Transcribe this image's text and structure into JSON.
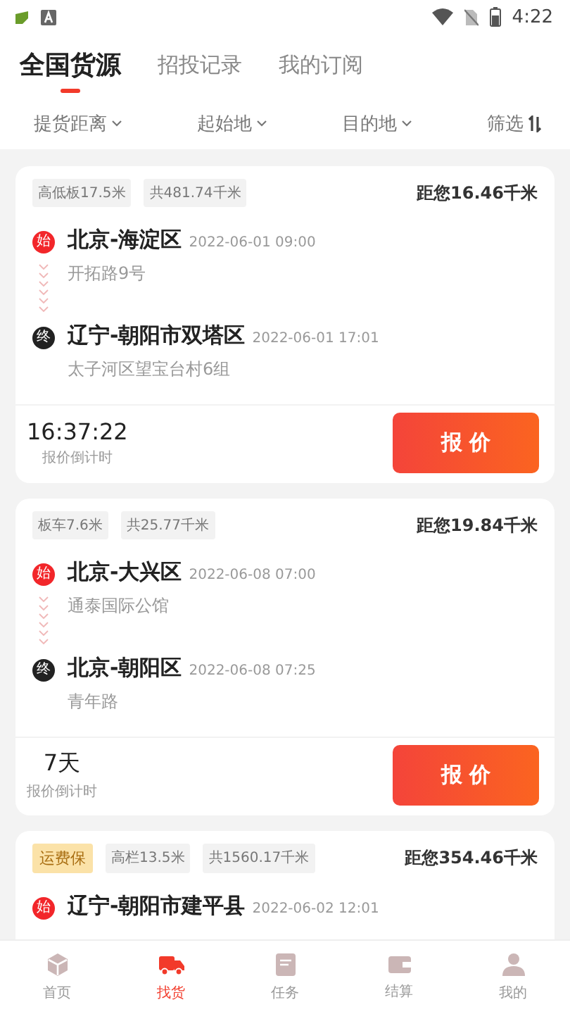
{
  "status_bar": {
    "time": "4:22"
  },
  "tabs": [
    {
      "label": "全国货源",
      "selected": true
    },
    {
      "label": "招投记录",
      "selected": false
    },
    {
      "label": "我的订阅",
      "selected": false
    }
  ],
  "filters": [
    {
      "label": "提货距离",
      "kind": "dropdown"
    },
    {
      "label": "起始地",
      "kind": "dropdown"
    },
    {
      "label": "目的地",
      "kind": "dropdown"
    },
    {
      "label": "筛选",
      "kind": "sort"
    }
  ],
  "cards": [
    {
      "tags": [
        {
          "text": "高低板17.5米",
          "kind": "spec"
        },
        {
          "text": "共481.74千米",
          "kind": "spec"
        }
      ],
      "distance": "距您16.46千米",
      "stops": [
        {
          "kind": "start",
          "mark": "始",
          "place": "北京-海淀区",
          "time": "2022-06-01 09:00",
          "address": "开拓路9号"
        },
        {
          "kind": "end",
          "mark": "终",
          "place": "辽宁-朝阳市双塔区",
          "time": "2022-06-01 17:01",
          "address": "太子河区望宝台村6组"
        }
      ],
      "countdown": "16:37:22",
      "countdown_label": "报价倒计时",
      "button": "报 价"
    },
    {
      "tags": [
        {
          "text": "板车7.6米",
          "kind": "spec"
        },
        {
          "text": "共25.77千米",
          "kind": "spec"
        }
      ],
      "distance": "距您19.84千米",
      "stops": [
        {
          "kind": "start",
          "mark": "始",
          "place": "北京-大兴区",
          "time": "2022-06-08 07:00",
          "address": "通泰国际公馆"
        },
        {
          "kind": "end",
          "mark": "终",
          "place": "北京-朝阳区",
          "time": "2022-06-08 07:25",
          "address": "青年路"
        }
      ],
      "countdown": "7天",
      "countdown_label": "报价倒计时",
      "button": "报 价"
    },
    {
      "tags": [
        {
          "text": "运费保",
          "kind": "insurance"
        },
        {
          "text": "高栏13.5米",
          "kind": "spec"
        },
        {
          "text": "共1560.17千米",
          "kind": "spec"
        }
      ],
      "distance": "距您354.46千米",
      "stops": [
        {
          "kind": "start",
          "mark": "始",
          "place": "辽宁-朝阳市建平县",
          "time": "2022-06-02 12:01"
        }
      ]
    }
  ],
  "nav": [
    {
      "label": "首页",
      "kind": "home",
      "selected": false
    },
    {
      "label": "找货",
      "kind": "truck",
      "selected": true
    },
    {
      "label": "任务",
      "kind": "task",
      "selected": false
    },
    {
      "label": "结算",
      "kind": "wallet",
      "selected": false
    },
    {
      "label": "我的",
      "kind": "user",
      "selected": false
    }
  ]
}
